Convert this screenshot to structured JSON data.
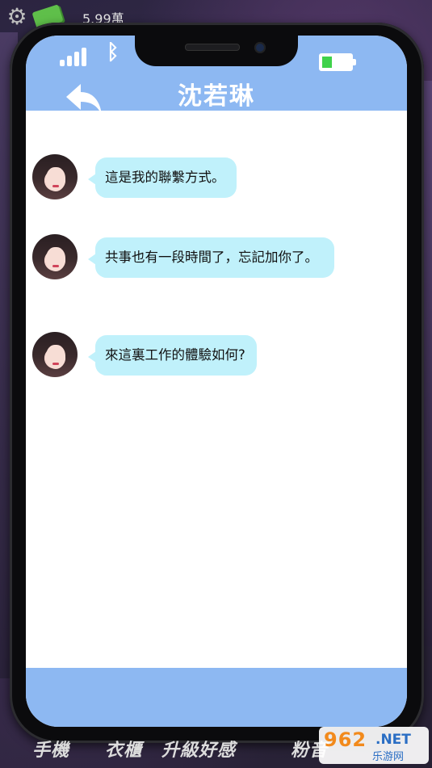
{
  "topbar": {
    "money": "5.99萬",
    "gear_icon": "gear-icon",
    "money_icon": "cash-icon"
  },
  "phone": {
    "status": {
      "signal_icon": "signal-bars-icon",
      "bluetooth_icon": "bluetooth-icon",
      "battery_icon": "battery-icon",
      "battery_level": 0.35,
      "battery_color": "#3fd24a"
    },
    "header": {
      "title": "沈若琳",
      "back_icon": "back-arrow-icon",
      "color": "#8db8f2"
    },
    "messages": [
      {
        "sender_avatar": "avatar-shen-ruolin",
        "text": "這是我的聯繫方式。"
      },
      {
        "sender_avatar": "avatar-shen-ruolin",
        "text": "共事也有一段時間了，忘記加你了。"
      },
      {
        "sender_avatar": "avatar-shen-ruolin",
        "text": "來這裏工作的體驗如何?"
      }
    ],
    "bubble_color": "#c0f1fb"
  },
  "bottom_nav": [
    "手機",
    "衣櫃",
    "升級好感",
    "粉音"
  ],
  "watermark": {
    "brand": "962.NET",
    "brand_number": "962",
    "brand_suffix": ".NET",
    "subtitle": "乐游网"
  }
}
